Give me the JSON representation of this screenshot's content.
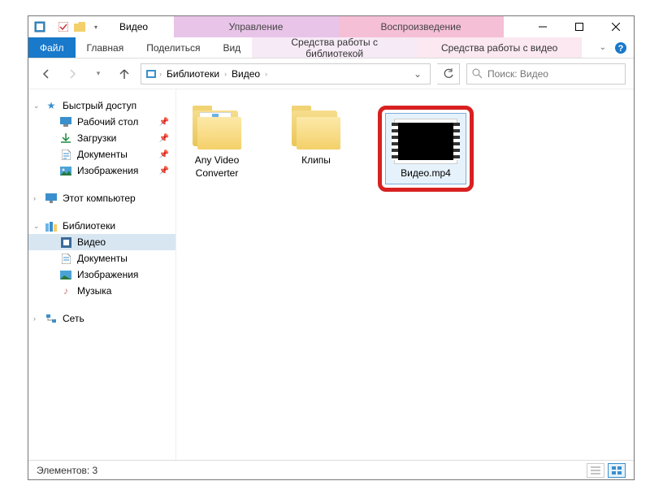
{
  "window_title": "Видео",
  "contextual": {
    "group1": "Управление",
    "group2": "Воспроизведение",
    "tab1": "Средства работы с библиотекой",
    "tab2": "Средства работы с видео"
  },
  "tabs": {
    "file": "Файл",
    "home": "Главная",
    "share": "Поделиться",
    "view": "Вид"
  },
  "breadcrumb": {
    "seg1": "Библиотеки",
    "seg2": "Видео"
  },
  "search": {
    "placeholder": "Поиск: Видео"
  },
  "sidebar": {
    "quick_access": "Быстрый доступ",
    "desktop": "Рабочий стол",
    "downloads": "Загрузки",
    "documents": "Документы",
    "pictures": "Изображения",
    "this_pc": "Этот компьютер",
    "libraries": "Библиотеки",
    "videos": "Видео",
    "lib_documents": "Документы",
    "lib_pictures": "Изображения",
    "music": "Музыка",
    "network": "Сеть"
  },
  "items": [
    {
      "name": "Any Video Converter",
      "type": "folder"
    },
    {
      "name": "Клипы",
      "type": "folder"
    },
    {
      "name": "Видео.mp4",
      "type": "video"
    }
  ],
  "status": {
    "count_label": "Элементов:",
    "count": "3"
  }
}
